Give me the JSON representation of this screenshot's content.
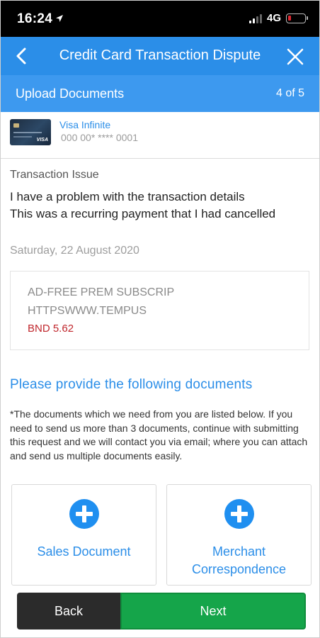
{
  "status_bar": {
    "time": "16:24",
    "network": "4G"
  },
  "header": {
    "title": "Credit Card Transaction Dispute",
    "step_title": "Upload Documents",
    "step_count": "4 of 5"
  },
  "card": {
    "name": "Visa Infinite",
    "number": "000 00* **** 0001",
    "brand": "VISA"
  },
  "issue": {
    "label": "Transaction Issue",
    "lines": [
      "I have a problem with the transaction details",
      "This was a recurring payment that I had cancelled"
    ]
  },
  "transaction": {
    "date": "Saturday, 22 August 2020",
    "merchant_lines": [
      "AD-FREE PREM SUBSCRIP",
      "HTTPSWWW.TEMPUS"
    ],
    "amount": "BND 5.62"
  },
  "documents": {
    "heading": "Please provide the following documents",
    "note": "*The documents which we need from you are listed below. If you need to send us more than 3 documents, continue with submitting this request and we will contact you via email; where you can attach and send us multiple documents easily.",
    "tiles": [
      {
        "label": "Sales Document"
      },
      {
        "label": "Merchant Correspondence"
      }
    ]
  },
  "footer": {
    "back_label": "Back",
    "next_label": "Next"
  },
  "colors": {
    "primary": "#2b8ee8",
    "next_green": "#15a54a",
    "amount_red": "#c0272d",
    "back_dark": "#2b2b2b"
  }
}
